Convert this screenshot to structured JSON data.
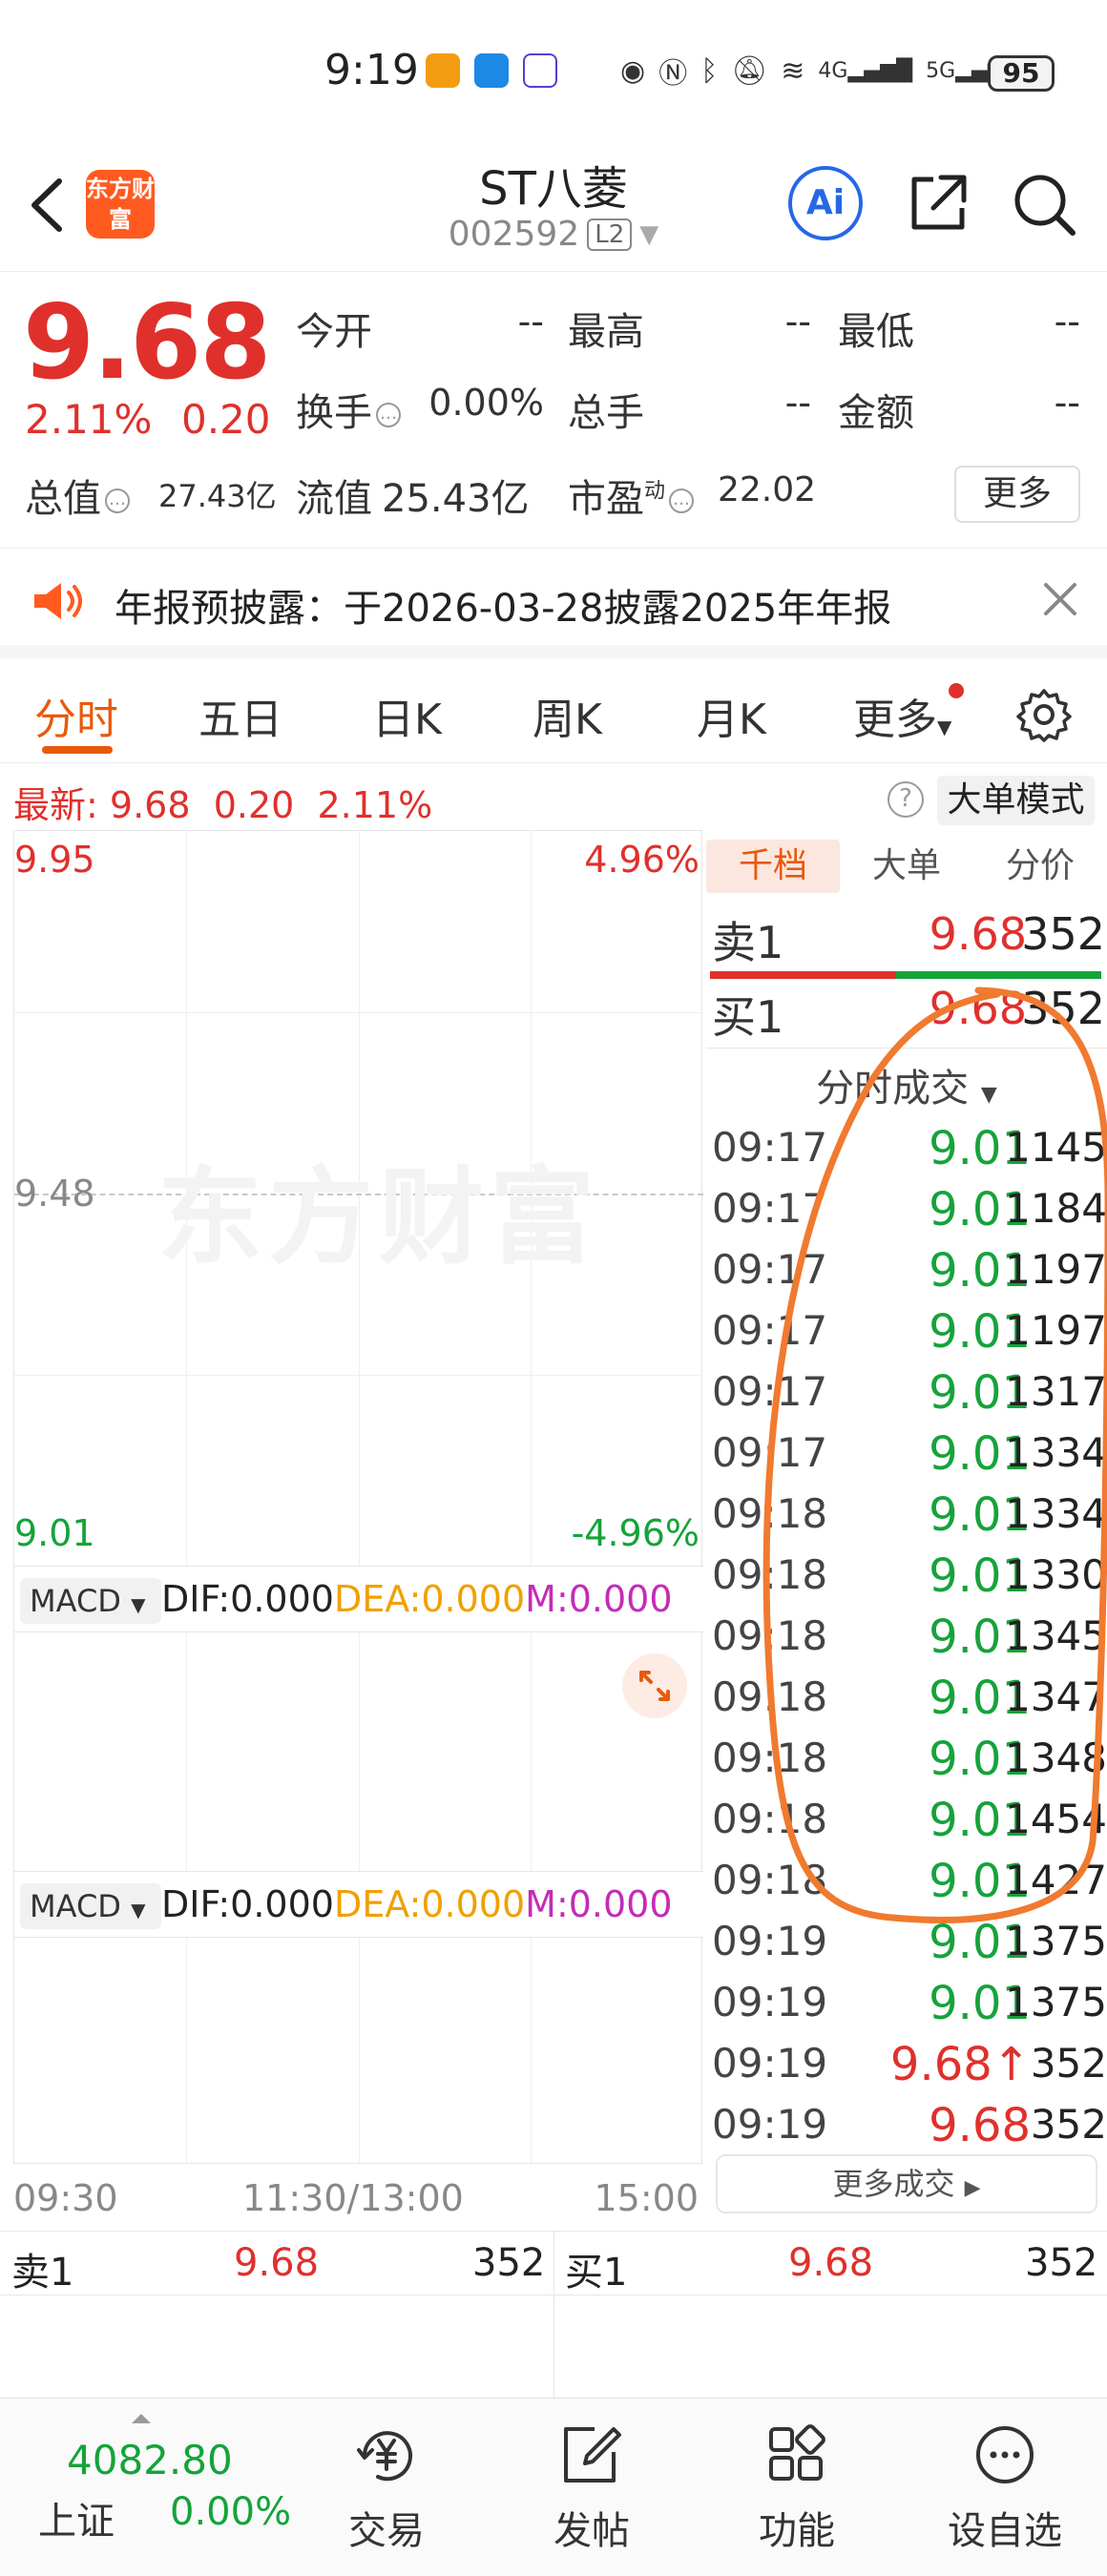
{
  "status_bar": {
    "time": "9:19",
    "network_1": "4G",
    "network_2": "5G",
    "battery": "95"
  },
  "header": {
    "logo_text": "东方财富",
    "stock_name": "ST八菱",
    "stock_code": "002592",
    "level_badge": "L2",
    "ai_label": "Ai"
  },
  "quote": {
    "price": "9.68",
    "change_pct": "2.11%",
    "change_amt": "0.20",
    "open_label": "今开",
    "open_value": "--",
    "high_label": "最高",
    "high_value": "--",
    "low_label": "最低",
    "low_value": "--",
    "turnover_label": "换手",
    "turnover_value": "0.00%",
    "volume_label": "总手",
    "volume_value": "--",
    "amount_label": "金额",
    "amount_value": "--",
    "mktcap_label": "总值",
    "mktcap_value": "27.43亿",
    "float_label": "流值",
    "float_value": "25.43亿",
    "pe_label": "市盈",
    "pe_sup": "动",
    "pe_value": "22.02",
    "more_label": "更多"
  },
  "notice": {
    "text": "年报预披露：于2026-03-28披露2025年年报"
  },
  "tabs": [
    "分时",
    "五日",
    "日K",
    "周K",
    "月K",
    "更多"
  ],
  "latest": {
    "label": "最新:",
    "price": "9.68",
    "change": "0.20",
    "pct": "2.11%",
    "mode_label": "大单模式"
  },
  "chart": {
    "top_price": "9.95",
    "top_pct": "4.96%",
    "mid_price": "9.48",
    "bottom_price": "9.01",
    "bottom_pct": "-4.96%",
    "watermark": "东方财富",
    "macd": {
      "select": "MACD",
      "dif": "DIF:0.000",
      "dea": "DEA:0.000",
      "m": "M:0.000"
    },
    "time_start": "09:30",
    "time_mid": "11:30/13:00",
    "time_end": "15:00"
  },
  "side": {
    "tabs": [
      "千档",
      "大单",
      "分价"
    ],
    "sell1_label": "卖1",
    "sell1_price": "9.68",
    "sell1_vol": "352",
    "buy1_label": "买1",
    "buy1_price": "9.68",
    "buy1_vol": "352",
    "ticks_header": "分时成交",
    "ticks": [
      {
        "time": "09:17",
        "price": "9.01",
        "vol": "1145",
        "dir": "down"
      },
      {
        "time": "09:17",
        "price": "9.01",
        "vol": "1184",
        "dir": "down"
      },
      {
        "time": "09:17",
        "price": "9.01",
        "vol": "1197",
        "dir": "down"
      },
      {
        "time": "09:17",
        "price": "9.01",
        "vol": "1197",
        "dir": "down"
      },
      {
        "time": "09:17",
        "price": "9.01",
        "vol": "1317",
        "dir": "down"
      },
      {
        "time": "09:17",
        "price": "9.01",
        "vol": "1334",
        "dir": "down"
      },
      {
        "time": "09:18",
        "price": "9.01",
        "vol": "1334",
        "dir": "down"
      },
      {
        "time": "09:18",
        "price": "9.01",
        "vol": "1330",
        "dir": "down"
      },
      {
        "time": "09:18",
        "price": "9.01",
        "vol": "1345",
        "dir": "down"
      },
      {
        "time": "09:18",
        "price": "9.01",
        "vol": "1347",
        "dir": "down"
      },
      {
        "time": "09:18",
        "price": "9.01",
        "vol": "1348",
        "dir": "down"
      },
      {
        "time": "09:18",
        "price": "9.01",
        "vol": "1454",
        "dir": "down"
      },
      {
        "time": "09:18",
        "price": "9.01",
        "vol": "1427",
        "dir": "down"
      },
      {
        "time": "09:19",
        "price": "9.01",
        "vol": "1375",
        "dir": "down"
      },
      {
        "time": "09:19",
        "price": "9.01",
        "vol": "1375",
        "dir": "down"
      },
      {
        "time": "09:19",
        "price": "9.68↑",
        "vol": "352",
        "dir": "up"
      },
      {
        "time": "09:19",
        "price": "9.68",
        "vol": "352",
        "dir": "up"
      }
    ],
    "more_trades": "更多成交"
  },
  "bottom_quotes": {
    "sell_label": "卖1",
    "sell_price": "9.68",
    "sell_vol": "352",
    "buy_label": "买1",
    "buy_price": "9.68",
    "buy_vol": "352"
  },
  "nav": {
    "index_value": "4082.80",
    "index_name": "上证",
    "index_change": "0.00%",
    "items": [
      "交易",
      "发帖",
      "功能",
      "设自选"
    ]
  },
  "colors": {
    "up": "#e0302c",
    "down": "#15a33a",
    "accent": "#e8590c",
    "dea": "#f0a000",
    "m": "#c42bb8"
  }
}
